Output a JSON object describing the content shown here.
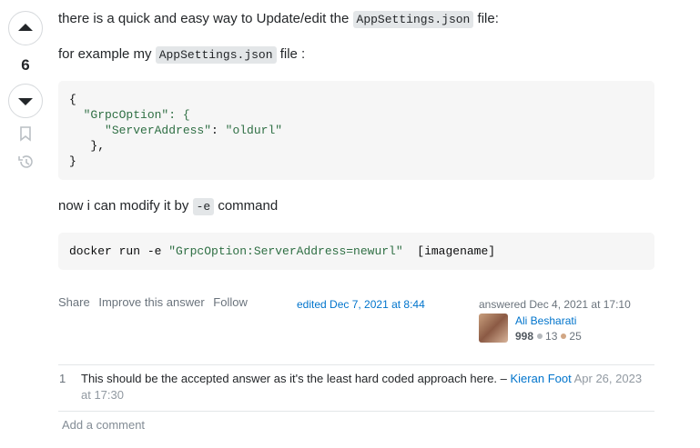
{
  "vote": {
    "count": "6"
  },
  "post": {
    "p1_text": "there is a quick and easy way to Update/edit the ",
    "p1_code": "AppSettings.json",
    "p1_end": " file:",
    "p2_text": "for example my ",
    "p2_code": "AppSettings.json",
    "p2_end": " file :",
    "code_block_1": [
      "{",
      "  \"GrpcOption\": {",
      "     \"ServerAddress\": \"oldurl\"",
      "   },",
      "}"
    ],
    "p3_text": "now i can modify it by ",
    "p3_code": "-e",
    "p3_end": " command",
    "code_block_2_prefix": "docker run -e ",
    "code_block_2_string": "\"GrpcOption:ServerAddress=newurl\"",
    "code_block_2_suffix": "  [imagename]"
  },
  "menu": {
    "share": "Share",
    "improve": "Improve this answer",
    "follow": "Follow"
  },
  "edited": "edited Dec 7, 2021 at 8:44",
  "answered": "answered Dec 4, 2021 at 17:10",
  "user": {
    "name": "Ali Besharati",
    "rep": "998",
    "silver": "13",
    "bronze": "25"
  },
  "comments": [
    {
      "score": "1",
      "text": "This should be the accepted answer as it's the least hard coded approach here. – ",
      "user": "Kieran Foot",
      "date": "Apr 26, 2023 at 17:30"
    }
  ],
  "add_comment": "Add a comment",
  "colors": {
    "link": "#0074cc",
    "code_bg": "#f6f6f6",
    "inline_code_bg": "#e3e6e8"
  }
}
